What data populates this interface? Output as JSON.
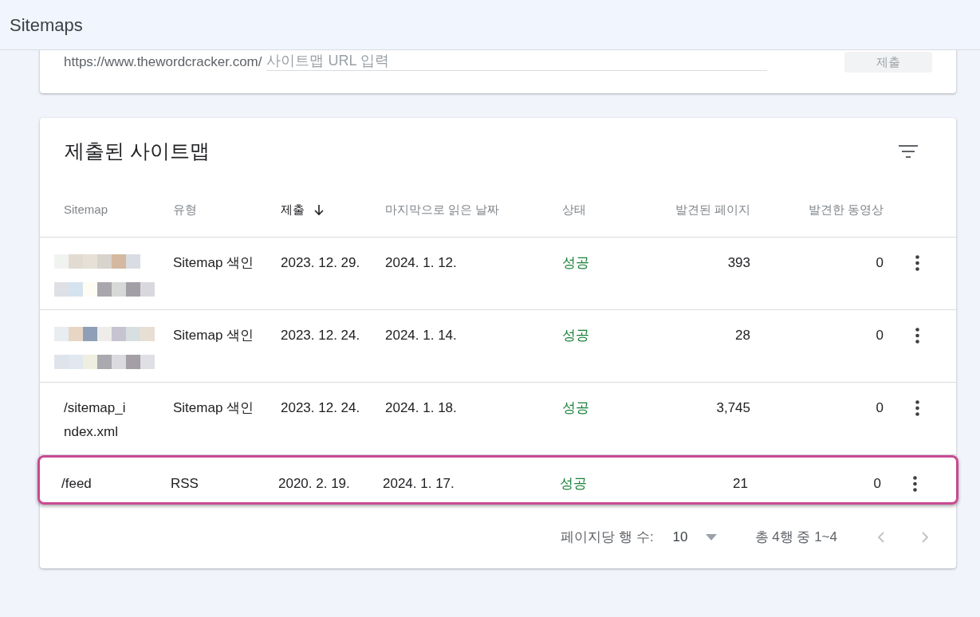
{
  "header": {
    "title": "Sitemaps"
  },
  "add_sitemap": {
    "prefix": "https://www.thewordcracker.com/",
    "placeholder": "사이트맵 URL 입력",
    "button": "제출"
  },
  "submitted": {
    "title": "제출된 사이트맵",
    "columns": [
      {
        "label": "Sitemap",
        "sorted": false
      },
      {
        "label": "유형",
        "sorted": false
      },
      {
        "label": "제출",
        "sorted": true
      },
      {
        "label": "마지막으로 읽은 날짜",
        "sorted": false
      },
      {
        "label": "상태",
        "sorted": false
      },
      {
        "label": "발견된 페이지",
        "sorted": false
      },
      {
        "label": "발견한 동영상",
        "sorted": false
      }
    ],
    "rows": [
      {
        "type": "Sitemap 색인",
        "submitted": "2023. 12. 29.",
        "last_read": "2024. 1. 12.",
        "status": "성공",
        "pages": "393",
        "videos": "0",
        "highlighted": false
      },
      {
        "type": "Sitemap 색인",
        "submitted": "2023. 12. 24.",
        "last_read": "2024. 1. 14.",
        "status": "성공",
        "pages": "28",
        "videos": "0",
        "highlighted": false
      },
      {
        "sitemap": {
          "kind": "text",
          "text": "/sitemap_index.xml"
        },
        "type": "Sitemap 색인",
        "submitted": "2023. 12. 24.",
        "last_read": "2024. 1. 18.",
        "status": "성공",
        "pages": "3,745",
        "videos": "0",
        "highlighted": false
      },
      {
        "sitemap": {
          "kind": "text",
          "text": "/feed"
        },
        "type": "RSS",
        "submitted": "2020. 2. 19.",
        "last_read": "2024. 1. 17.",
        "status": "성공",
        "pages": "21",
        "videos": "0",
        "highlighted": true
      }
    ],
    "pagination": {
      "rows_per_page_label": "페이지당 행 수:",
      "rows_per_page": "10",
      "range": "총 4행 중 1~4",
      "prev_disabled": true,
      "next_disabled": true
    }
  }
}
